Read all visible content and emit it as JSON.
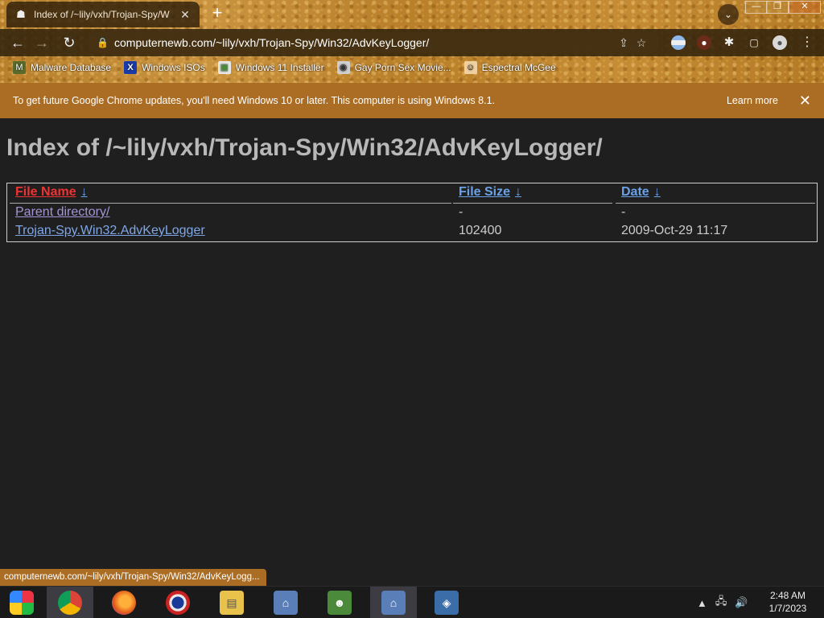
{
  "browser": {
    "tab": {
      "title": "Index of /~lily/vxh/Trojan-Spy/W",
      "favicon": "incognito-hat-icon"
    },
    "new_tab_label": "+",
    "tab_search_glyph": "⌄",
    "window_controls": {
      "minimize": "—",
      "maximize": "❐",
      "close": "✕"
    },
    "nav": {
      "back": "←",
      "forward": "→",
      "reload": "↻"
    },
    "url": "computernewb.com/~lily/vxh/Trojan-Spy/Win32/AdvKeyLogger/",
    "omnibox_icons": {
      "lock": "🔒",
      "share": "⇪",
      "star": "☆"
    },
    "toolbar_icons": {
      "extension1": "flag-icon",
      "extension2": "avatar-icon",
      "puzzle": "✱",
      "side_panel": "▢",
      "profile": "●",
      "menu": "⋮"
    },
    "bookmarks": [
      {
        "label": "Malware Database",
        "icon": "M"
      },
      {
        "label": "Windows ISOs",
        "icon": "X"
      },
      {
        "label": "Windows 11 Installer",
        "icon": "▣"
      },
      {
        "label": "Gay Porn Sex Movie...",
        "icon": "◉"
      },
      {
        "label": "Espectral McGee",
        "icon": "☺"
      }
    ],
    "infobar": {
      "message": "To get future Google Chrome updates, you'll need Windows 10 or later. This computer is using Windows 8.1.",
      "action": "Learn more",
      "close": "✕"
    },
    "status_bubble": "computernewb.com/~lily/vxh/Trojan-Spy/Win32/AdvKeyLogg..."
  },
  "page": {
    "heading": "Index of /~lily/vxh/Trojan-Spy/Win32/AdvKeyLogger/",
    "columns": [
      {
        "label": "File Name",
        "sort": "↓"
      },
      {
        "label": "File Size",
        "sort": "↓"
      },
      {
        "label": "Date",
        "sort": "↓"
      }
    ],
    "rows": [
      {
        "name": "Parent directory/",
        "size": "-",
        "date": "-"
      },
      {
        "name": "Trojan-Spy.Win32.AdvKeyLogger",
        "size": "102400",
        "date": "2009-Oct-29 11:17"
      }
    ]
  },
  "taskbar": {
    "items": [
      "start-orb-icon",
      "chrome-icon",
      "firefox-icon",
      "opera-icon",
      "file-explorer-icon",
      "network-icon",
      "people-icon",
      "network-icon",
      "virtualbox-icon"
    ],
    "tray": {
      "expand": "▲",
      "network": "🖧",
      "volume": "🔊"
    },
    "time": "2:48 AM",
    "date": "1/7/2023"
  },
  "colors": {
    "infobar": "#ab6d24",
    "page_bg": "#1f1f1f",
    "link": "#6aa2e8",
    "visited_link": "#a594d8",
    "active_header": "#e33333"
  }
}
